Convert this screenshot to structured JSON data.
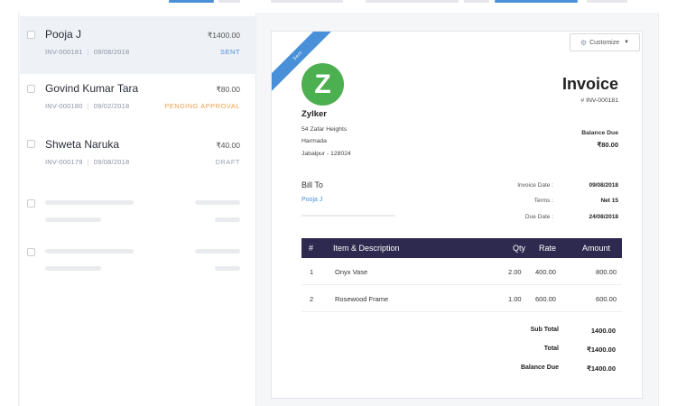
{
  "invoices": [
    {
      "customer": "Pooja J",
      "amount": "₹1400.00",
      "number": "INV-000181",
      "date": "09/08/2018",
      "status": "SENT"
    },
    {
      "customer": "Govind Kumar Tara",
      "amount": "₹80.00",
      "number": "INV-000180",
      "date": "09/02/2018",
      "status": "PENDING APPROVAL"
    },
    {
      "customer": "Shweta Naruka",
      "amount": "₹40.00",
      "number": "INV-000179",
      "date": "09/08/2018",
      "status": "DRAFT"
    }
  ],
  "detail": {
    "ribbon": "Sent",
    "customize_label": "Customize",
    "logo_letter": "Z",
    "org_name": "Zylker",
    "address": [
      "54 Zafar Heights",
      "Harmada",
      "Jabalpur - 128024"
    ],
    "title": "Invoice",
    "number": "# INV-000181",
    "balance_due_label": "Balance Due",
    "balance_due_value": "₹80.00",
    "bill_to_label": "Bill To",
    "bill_to_name": "Pooja J",
    "dates": [
      {
        "label": "Invoice Date :",
        "value": "09/08/2018"
      },
      {
        "label": "Terms :",
        "value": "Net 15"
      },
      {
        "label": "Due Date :",
        "value": "24/08/2018"
      }
    ],
    "table": {
      "headers": {
        "num": "#",
        "item": "Item & Description",
        "qty": "Qty",
        "rate": "Rate",
        "amount": "Amount"
      },
      "rows": [
        {
          "num": "1",
          "item": "Onyx Vase",
          "qty": "2.00",
          "rate": "400.00",
          "amount": "800.00"
        },
        {
          "num": "2",
          "item": "Rosewood Frame",
          "qty": "1.00",
          "rate": "600.00",
          "amount": "600.00"
        }
      ]
    },
    "totals": [
      {
        "label": "Sub Total",
        "value": "1400.00"
      },
      {
        "label": "Total",
        "value": "₹1400.00"
      },
      {
        "label": "Balance Due",
        "value": "₹1400.00"
      }
    ]
  },
  "colors": {
    "accent": "#4a90d9",
    "table_header": "#2e2a4f",
    "logo": "#4caf50",
    "pending": "#f0a04b"
  }
}
